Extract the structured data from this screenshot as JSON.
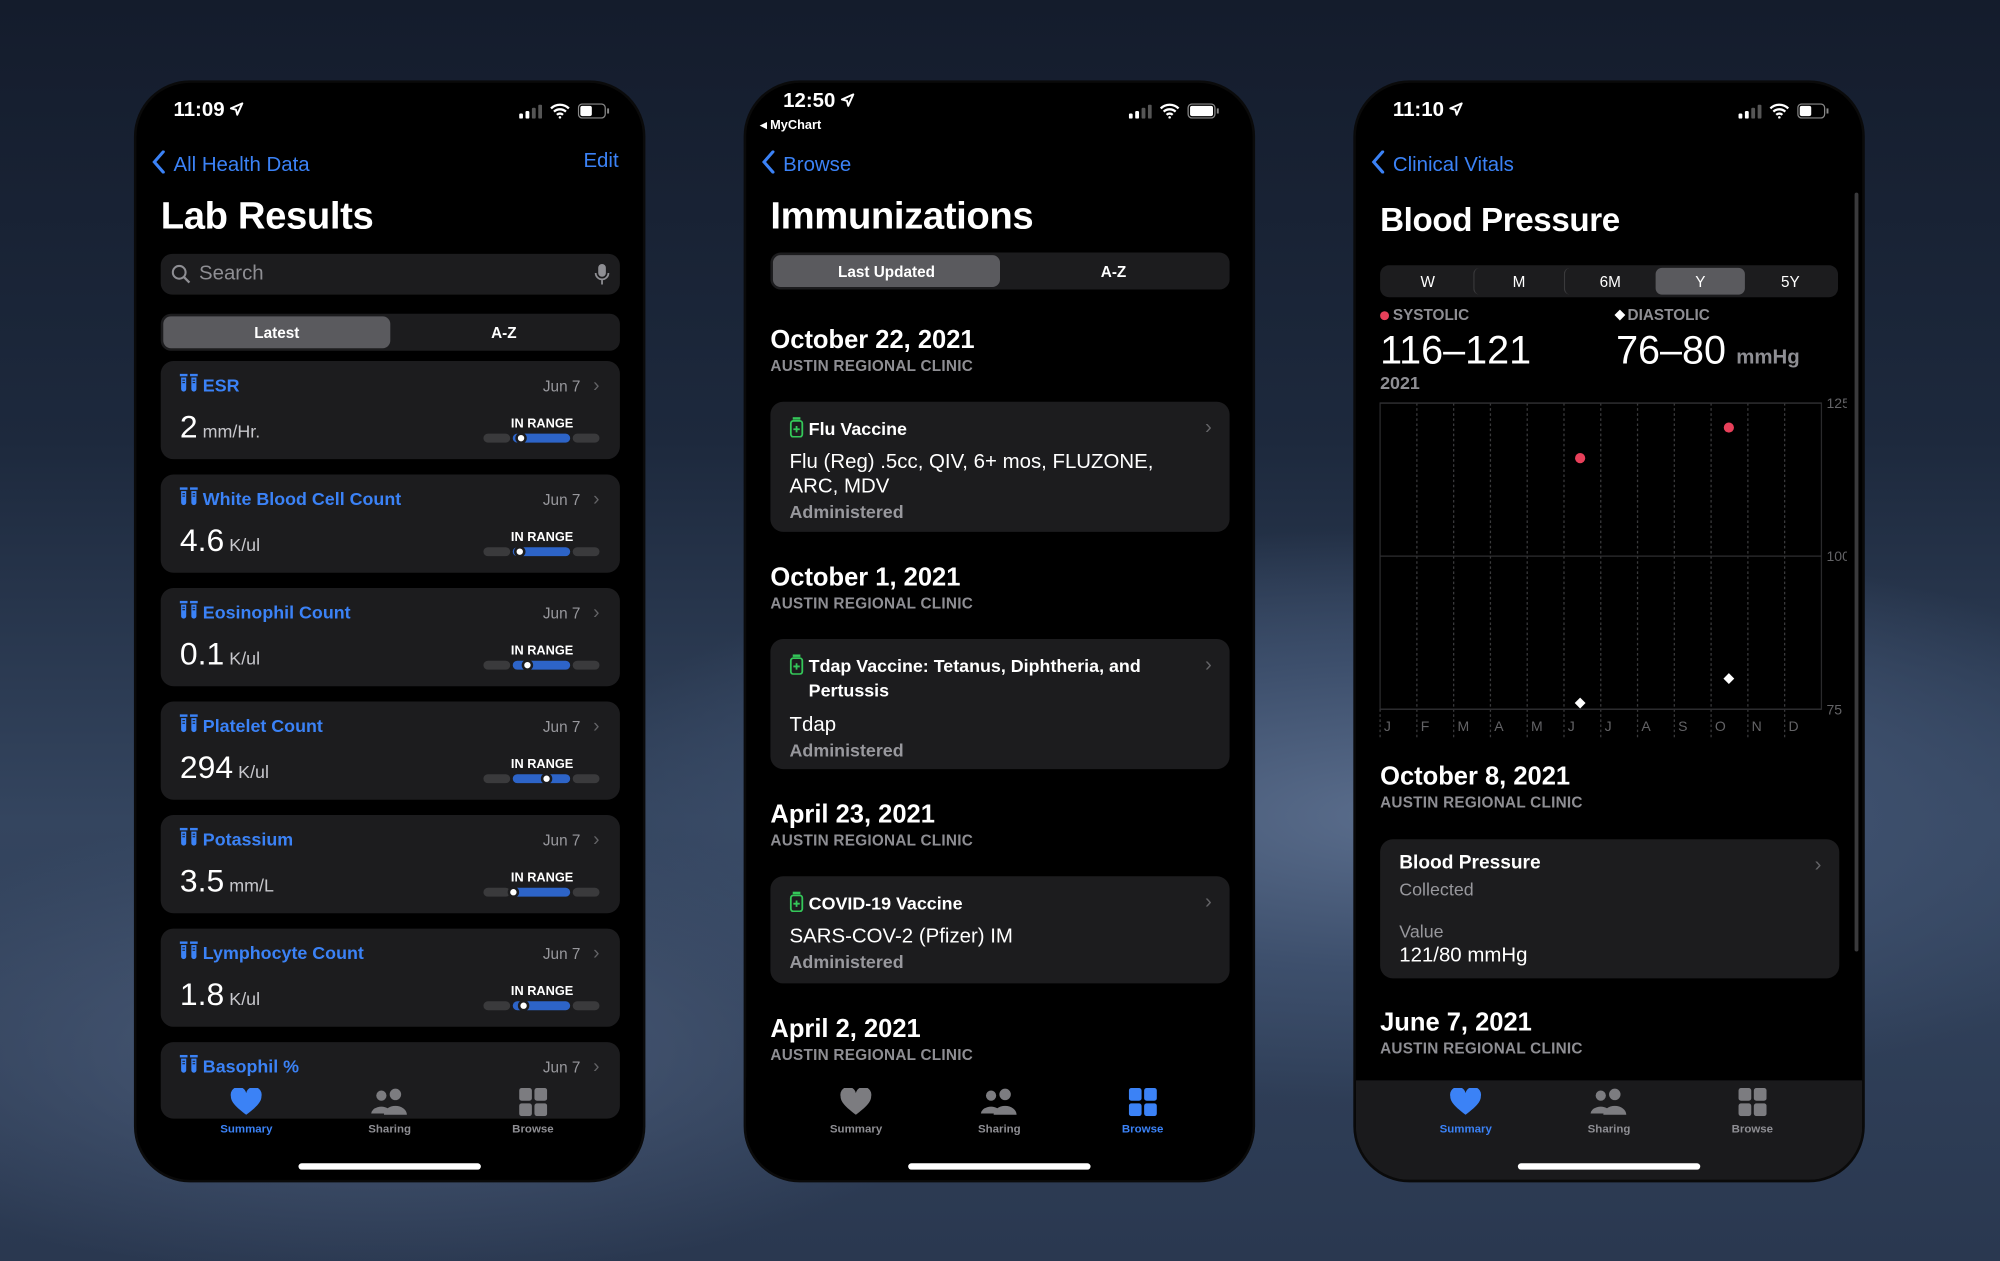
{
  "colors": {
    "accent": "#3b82f6",
    "systolic": "#e8405a",
    "diastolic": "#ffffff",
    "vaccine_icon": "#34c759"
  },
  "tab_bar": {
    "items": [
      {
        "label": "Summary",
        "icon": "heart-icon"
      },
      {
        "label": "Sharing",
        "icon": "people-icon"
      },
      {
        "label": "Browse",
        "icon": "grid-icon"
      }
    ]
  },
  "lab_screen": {
    "status_time": "11:09",
    "back_label": "All Health Data",
    "edit_label": "Edit",
    "title": "Lab Results",
    "search_placeholder": "Search",
    "segments": [
      "Latest",
      "A-Z"
    ],
    "selected_segment": 0,
    "active_tab": 0,
    "range_label": "IN RANGE",
    "items": [
      {
        "name": "ESR",
        "date": "Jun 7",
        "value": "2",
        "unit": "mm/Hr.",
        "range_position": 0.32
      },
      {
        "name": "White Blood Cell Count",
        "date": "Jun 7",
        "value": "4.6",
        "unit": "K/ul",
        "range_position": 0.31
      },
      {
        "name": "Eosinophil Count",
        "date": "Jun 7",
        "value": "0.1",
        "unit": "K/ul",
        "range_position": 0.37
      },
      {
        "name": "Platelet Count",
        "date": "Jun 7",
        "value": "294",
        "unit": "K/ul",
        "range_position": 0.54
      },
      {
        "name": "Potassium",
        "date": "Jun 7",
        "value": "3.5",
        "unit": "mm/L",
        "range_position": 0.25
      },
      {
        "name": "Lymphocyte Count",
        "date": "Jun 7",
        "value": "1.8",
        "unit": "K/ul",
        "range_position": 0.34
      },
      {
        "name": "Basophil %",
        "date": "Jun 7"
      }
    ]
  },
  "immunizations_screen": {
    "status_time": "12:50",
    "return_app": "MyChart",
    "back_label": "Browse",
    "title": "Immunizations",
    "segments": [
      "Last Updated",
      "A-Z"
    ],
    "selected_segment": 0,
    "active_tab": 2,
    "sections": [
      {
        "date": "October 22, 2021",
        "clinic": "AUSTIN REGIONAL CLINIC",
        "vaccine": "Flu Vaccine",
        "description": "Flu (Reg) .5cc, QIV, 6+ mos, FLUZONE, ARC, MDV",
        "status": "Administered"
      },
      {
        "date": "October 1, 2021",
        "clinic": "AUSTIN REGIONAL CLINIC",
        "vaccine": "Tdap Vaccine: Tetanus, Diphtheria, and Pertussis",
        "description": "Tdap",
        "status": "Administered"
      },
      {
        "date": "April 23, 2021",
        "clinic": "AUSTIN REGIONAL CLINIC",
        "vaccine": "COVID-19 Vaccine",
        "description": "SARS-COV-2 (Pfizer) IM",
        "status": "Administered"
      },
      {
        "date": "April 2, 2021",
        "clinic": "AUSTIN REGIONAL CLINIC"
      }
    ]
  },
  "bp_screen": {
    "status_time": "11:10",
    "back_label": "Clinical Vitals",
    "title": "Blood Pressure",
    "time_ranges": [
      "W",
      "M",
      "6M",
      "Y",
      "5Y"
    ],
    "selected_range": 3,
    "active_tab": 0,
    "systolic_label": "SYSTOLIC",
    "systolic_range": "116–121",
    "diastolic_label": "DIASTOLIC",
    "diastolic_range": "76–80",
    "unit": "mmHg",
    "period": "2021",
    "records": [
      {
        "date": "October 8, 2021",
        "clinic": "AUSTIN REGIONAL CLINIC",
        "card_title": "Blood Pressure",
        "card_status": "Collected",
        "value_label": "Value",
        "value": "121/80 mmHg"
      },
      {
        "date": "June 7, 2021",
        "clinic": "AUSTIN REGIONAL CLINIC"
      }
    ]
  },
  "chart_data": {
    "type": "scatter",
    "title": "",
    "xlabel": "",
    "ylabel": "",
    "categories": [
      "J",
      "F",
      "M",
      "A",
      "M",
      "J",
      "J",
      "A",
      "S",
      "O",
      "N",
      "D"
    ],
    "yticks": [
      125,
      100,
      75
    ],
    "ylim": [
      75,
      125
    ],
    "grid": true,
    "series": [
      {
        "name": "SYSTOLIC",
        "marker": "circle",
        "color": "#e8405a",
        "points": [
          {
            "x": "2021-06-07",
            "y": 116
          },
          {
            "x": "2021-10-08",
            "y": 121
          }
        ]
      },
      {
        "name": "DIASTOLIC",
        "marker": "diamond",
        "color": "#ffffff",
        "points": [
          {
            "x": "2021-06-07",
            "y": 76
          },
          {
            "x": "2021-10-08",
            "y": 80
          }
        ]
      }
    ]
  }
}
